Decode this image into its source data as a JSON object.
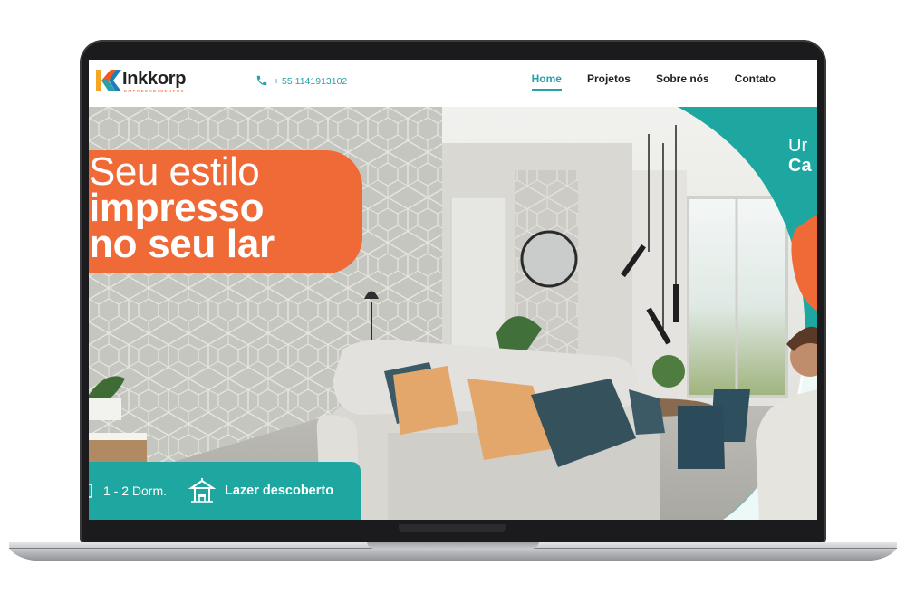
{
  "brand": {
    "name": "Inkkorp",
    "tagline": "EMPREENDIMENTOS",
    "colors": {
      "orange": "#ef6a36",
      "teal": "#1ea7a1",
      "accent": "#2aa0a8"
    }
  },
  "header": {
    "phone": "+ 55 1141913102",
    "phone_icon": "phone-icon",
    "nav": [
      {
        "label": "Home",
        "active": true
      },
      {
        "label": "Projetos",
        "active": false
      },
      {
        "label": "Sobre nós",
        "active": false
      },
      {
        "label": "Contato",
        "active": false
      }
    ]
  },
  "hero": {
    "headline_line1": "Seu estilo",
    "headline_line2": "impresso",
    "headline_line3": "no seu lar",
    "features": [
      {
        "icon": "bed-icon",
        "label": "1 - 2 Dorm."
      },
      {
        "icon": "gazebo-icon",
        "label": "Lazer descoberto"
      }
    ],
    "side_text_line1": "Ur",
    "side_text_line2": "Ca"
  }
}
